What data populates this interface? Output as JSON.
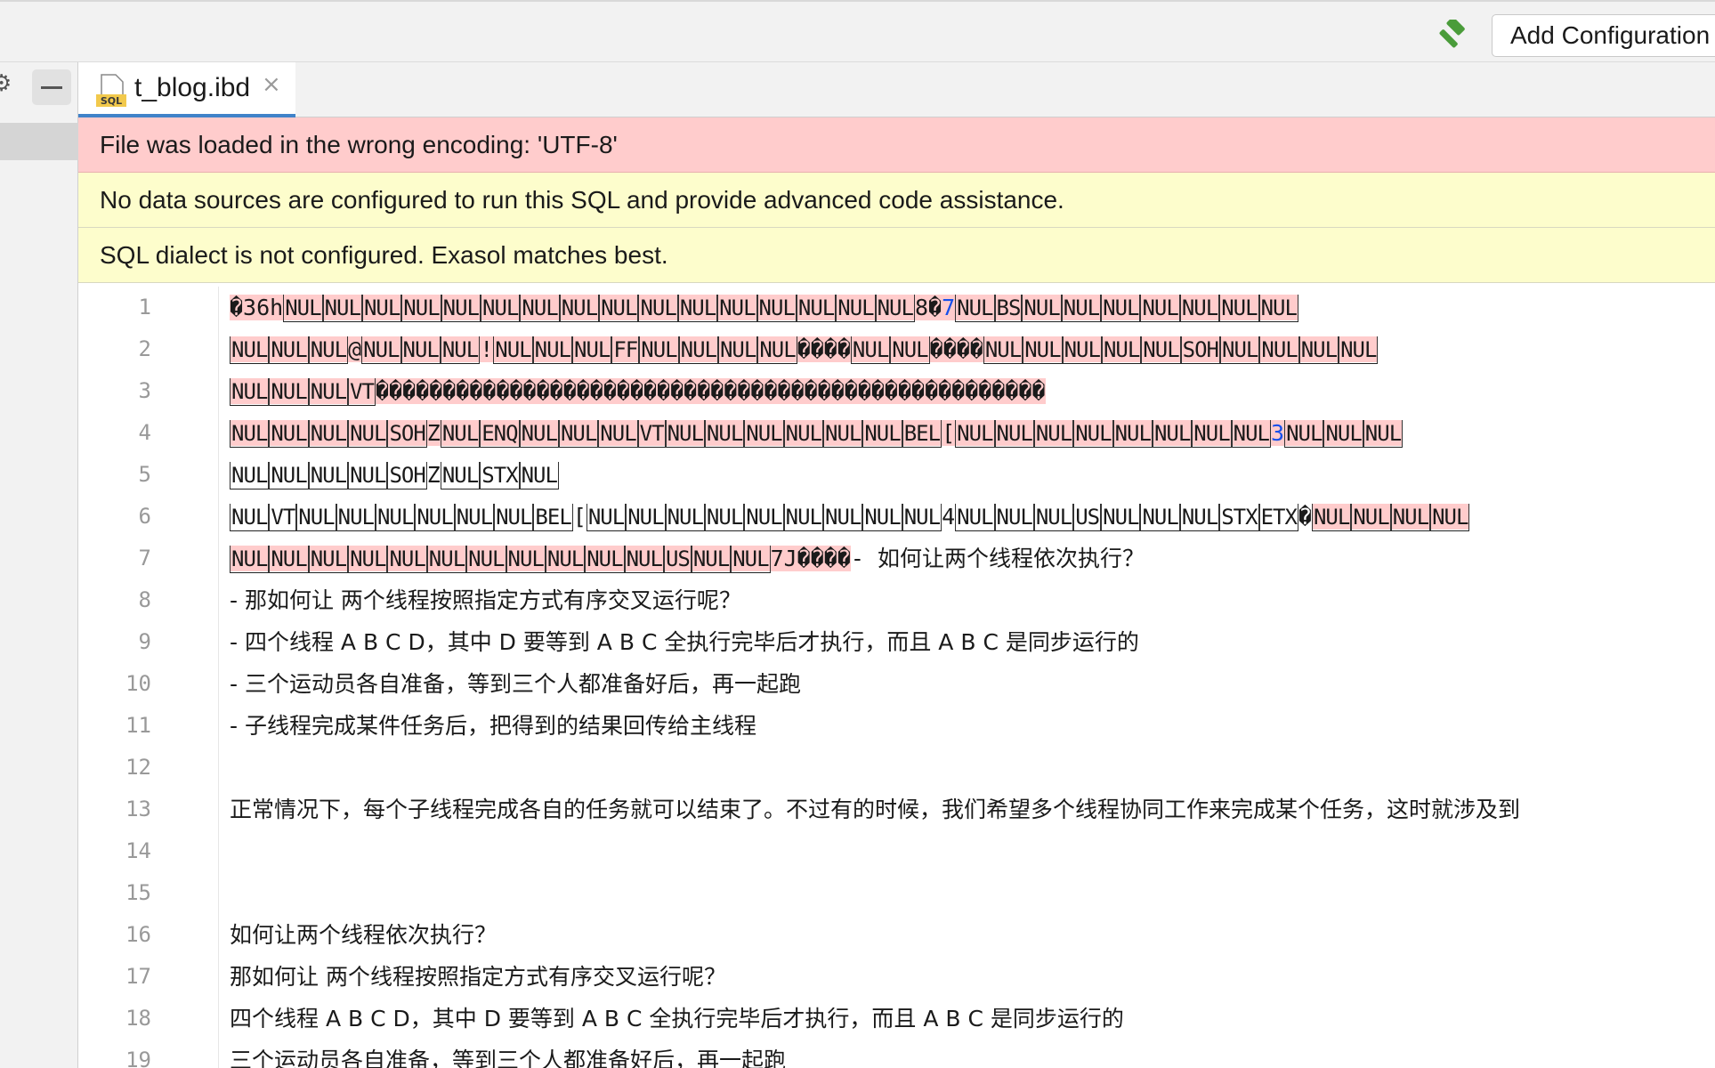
{
  "toolbar": {
    "hammer_icon": "hammer-icon",
    "add_configuration_label": "Add Configuration"
  },
  "tab": {
    "file_icon": "sql-file-icon",
    "icon_text": "SQL",
    "label": "t_blog.ibd",
    "close_glyph": "×"
  },
  "banners": {
    "encoding": "File was loaded in the wrong encoding: 'UTF-8'",
    "datasource": "No data sources are configured to run this SQL and provide advanced code assistance.",
    "dialect": "SQL dialect is not configured. Exasol matches best."
  },
  "editor": {
    "line_numbers": [
      "1",
      "2",
      "3",
      "4",
      "5",
      "6",
      "7",
      "8",
      "9",
      "10",
      "11",
      "12",
      "13",
      "14",
      "15",
      "16",
      "17",
      "18",
      "19"
    ],
    "line8": "- 那如何让 两个线程按照指定方式有序交叉运行呢？",
    "line9": "- 四个线程 A B C D，其中 D 要等到 A B C 全执行完毕后才执行，而且 A B C 是同步运行的",
    "line10": "- 三个运动员各自准备，等到三个人都准备好后，再一起跑",
    "line11": "- 子线程完成某件任务后，把得到的结果回传给主线程",
    "line13": "正常情况下，每个子线程完成各自的任务就可以结束了。不过有的时候，我们希望多个线程协同工作来完成某个任务，这时就涉及到",
    "line16": "如何让两个线程依次执行？",
    "line17": "那如何让 两个线程按照指定方式有序交叉运行呢？",
    "line18": "四个线程 A B C D，其中 D 要等到 A B C 全执行完毕后才执行，而且 A B C 是同步运行的",
    "line19": "三个运动员各自准备，等到三个人都准备好后，再一起跑",
    "line7_tail": "如何让两个线程依次执行？"
  },
  "colors": {
    "error_bg": "#ffcccc",
    "warning_bg": "#fdfdcc",
    "accent_tab": "#4083c9",
    "hammer_green": "#4a9c3a"
  }
}
